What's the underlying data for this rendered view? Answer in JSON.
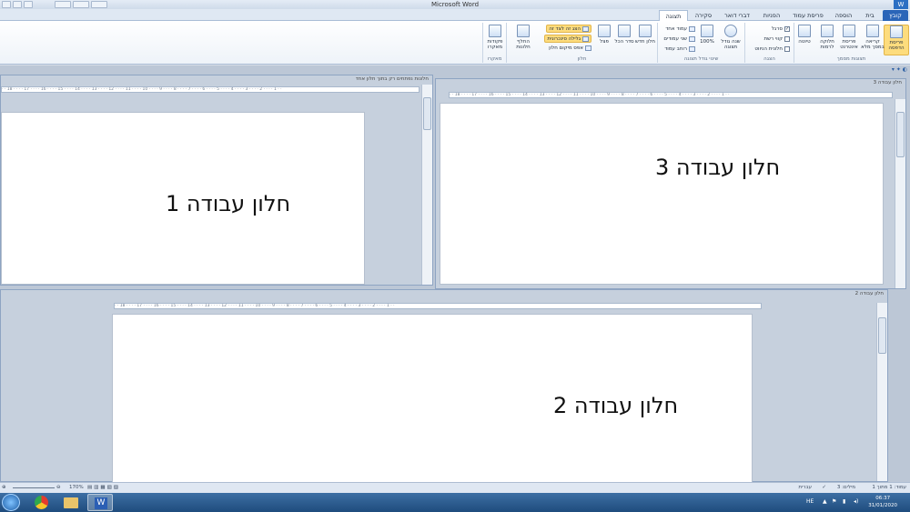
{
  "window": {
    "title": "Microsoft Word",
    "app_badge": "W"
  },
  "tabs": [
    {
      "label": "קובץ"
    },
    {
      "label": "בית"
    },
    {
      "label": "הוספה"
    },
    {
      "label": "פריסת עמוד"
    },
    {
      "label": "הפניות"
    },
    {
      "label": "דברי דואר"
    },
    {
      "label": "סקירה"
    },
    {
      "label": "תצוגה"
    }
  ],
  "ribbon": {
    "views": {
      "group_label": "תצוגות מסמך",
      "print_layout": "פריסת הדפסה",
      "full_screen": "קריאה במסך מלא",
      "web_layout": "פריסת אינטרנט",
      "outline": "חלוקה לרמות",
      "draft": "טיוטה"
    },
    "show": {
      "group_label": "הצגה",
      "ruler": "סרגל",
      "gridlines": "קווי רשת",
      "nav_pane": "חלונית הניווט",
      "ruler_checked": "✓"
    },
    "zoom": {
      "group_label": "שינוי גודל תצוגה",
      "zoom": "שנה גודל תצוגה",
      "percent": "100%",
      "one_page": "עמוד אחד",
      "two_pages": "שני עמודים",
      "page_width": "רוחב עמוד"
    },
    "window": {
      "group_label": "חלון",
      "new_window": "חלון חדש",
      "arrange_all": "סדר הכל",
      "split": "פצל",
      "side_by_side": "הצג זה לצד זה",
      "sync_scroll": "גלילה סינכרונית",
      "reset_position": "אפס מיקום חלון",
      "switch_windows": "החלף חלונות"
    },
    "macros": {
      "group_label": "מאקרו",
      "macros": "פקודות מאקרו"
    }
  },
  "panes": {
    "pane1": {
      "title": "חלונות נפתחים רק בתוך חלון אחד",
      "text": "חלון עבודה 1"
    },
    "pane3": {
      "title": "חלון עבודה 3",
      "text": "חלון עבודה 3"
    },
    "pane2": {
      "title": "חלון עבודה 2",
      "text": "חלון עבודה 2"
    }
  },
  "ruler_numbers": [
    "1",
    "2",
    "3",
    "4",
    "5",
    "6",
    "7",
    "8",
    "9",
    "10",
    "11",
    "12",
    "13",
    "14",
    "15",
    "16",
    "17",
    "18"
  ],
  "status": {
    "page": "עמוד: 1 מתוך 1",
    "words": "מילים: 3",
    "language": "עברית",
    "zoom": "170%"
  },
  "taskbar": {
    "lang": "HE",
    "time": "06:37",
    "date": "31/01/2020"
  }
}
